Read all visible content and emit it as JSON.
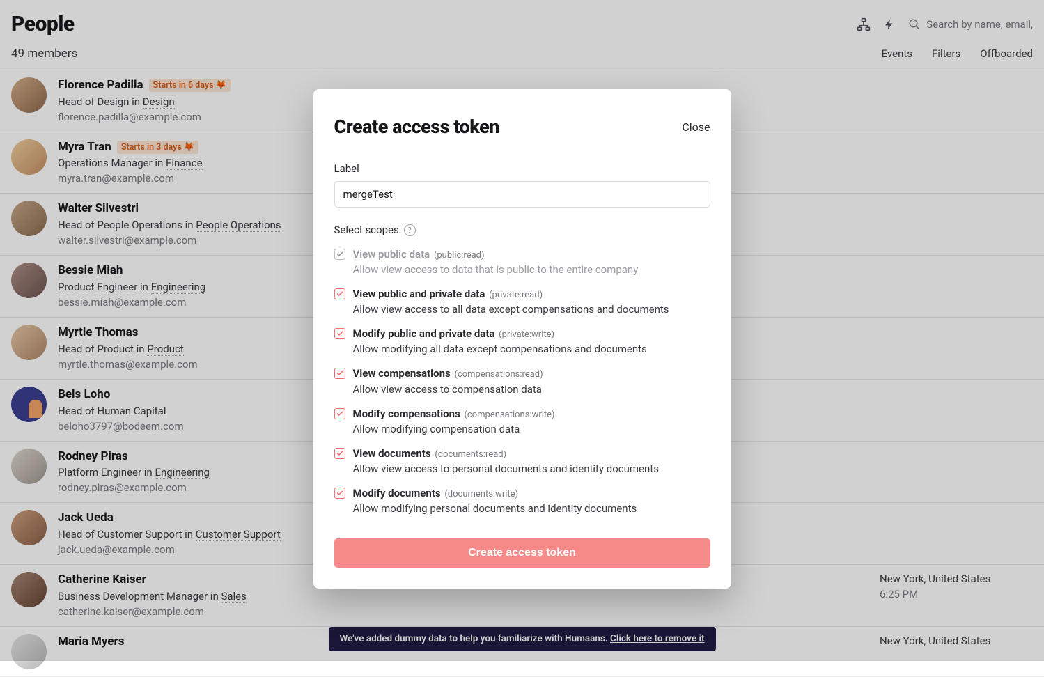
{
  "header": {
    "title": "People",
    "subtitle": "49 members",
    "search_placeholder": "Search by name, email,",
    "tabs": [
      "Events",
      "Filters",
      "Offboarded"
    ]
  },
  "people": [
    {
      "name": "Florence Padilla",
      "badge": "Starts in 6 days",
      "role_pre": "Head of Design in ",
      "dept": "Design",
      "email": "florence.padilla@example.com",
      "loc": "",
      "time": ""
    },
    {
      "name": "Myra Tran",
      "badge": "Starts in 3 days",
      "role_pre": "Operations Manager in ",
      "dept": "Finance",
      "email": "myra.tran@example.com",
      "loc": "",
      "time": ""
    },
    {
      "name": "Walter Silvestri",
      "badge": "",
      "role_pre": "Head of People Operations in ",
      "dept": "People Operations",
      "email": "walter.silvestri@example.com",
      "loc": "",
      "time": ""
    },
    {
      "name": "Bessie Miah",
      "badge": "",
      "role_pre": "Product Engineer in ",
      "dept": "Engineering",
      "email": "bessie.miah@example.com",
      "loc": "",
      "time": ""
    },
    {
      "name": "Myrtle Thomas",
      "badge": "",
      "role_pre": "Head of Product in ",
      "dept": "Product",
      "email": "myrtle.thomas@example.com",
      "loc": "",
      "time": ""
    },
    {
      "name": "Bels Loho",
      "badge": "",
      "role_pre": "Head of Human Capital",
      "dept": "",
      "email": "beloho3797@bodeem.com",
      "loc": "",
      "time": ""
    },
    {
      "name": "Rodney Piras",
      "badge": "",
      "role_pre": "Platform Engineer in ",
      "dept": "Engineering",
      "email": "rodney.piras@example.com",
      "loc": "",
      "time": ""
    },
    {
      "name": "Jack Ueda",
      "badge": "",
      "role_pre": "Head of Customer Support in ",
      "dept": "Customer Support",
      "email": "jack.ueda@example.com",
      "loc": "",
      "time": ""
    },
    {
      "name": "Catherine Kaiser",
      "badge": "",
      "role_pre": "Business Development Manager in ",
      "dept": "Sales",
      "email": "catherine.kaiser@example.com",
      "loc": "New York, United States",
      "time": "6:25 PM"
    },
    {
      "name": "Maria Myers",
      "badge": "",
      "role_pre": "",
      "dept": "",
      "email": "",
      "loc": "New York, United States",
      "time": ""
    }
  ],
  "banner": {
    "text_pre": "We've added dummy data to help you familiarize with Humaans. ",
    "link": "Click here to remove it"
  },
  "modal": {
    "title": "Create access token",
    "close": "Close",
    "label_field": "Label",
    "label_value": "mergeTest",
    "scopes_label": "Select scopes",
    "help": "?",
    "scopes": [
      {
        "title": "View public data",
        "slug": "(public:read)",
        "desc": "Allow view access to data that is public to the entire company",
        "checked": true,
        "disabled": true
      },
      {
        "title": "View public and private data",
        "slug": "(private:read)",
        "desc": "Allow view access to all data except compensations and documents",
        "checked": true,
        "disabled": false
      },
      {
        "title": "Modify public and private data",
        "slug": "(private:write)",
        "desc": "Allow modifying all data except compensations and documents",
        "checked": true,
        "disabled": false
      },
      {
        "title": "View compensations",
        "slug": "(compensations:read)",
        "desc": "Allow view access to compensation data",
        "checked": true,
        "disabled": false
      },
      {
        "title": "Modify compensations",
        "slug": "(compensations:write)",
        "desc": "Allow modifying compensation data",
        "checked": true,
        "disabled": false
      },
      {
        "title": "View documents",
        "slug": "(documents:read)",
        "desc": "Allow view access to personal documents and identity documents",
        "checked": true,
        "disabled": false
      },
      {
        "title": "Modify documents",
        "slug": "(documents:write)",
        "desc": "Allow modifying personal documents and identity documents",
        "checked": true,
        "disabled": false
      }
    ],
    "submit": "Create access token"
  }
}
